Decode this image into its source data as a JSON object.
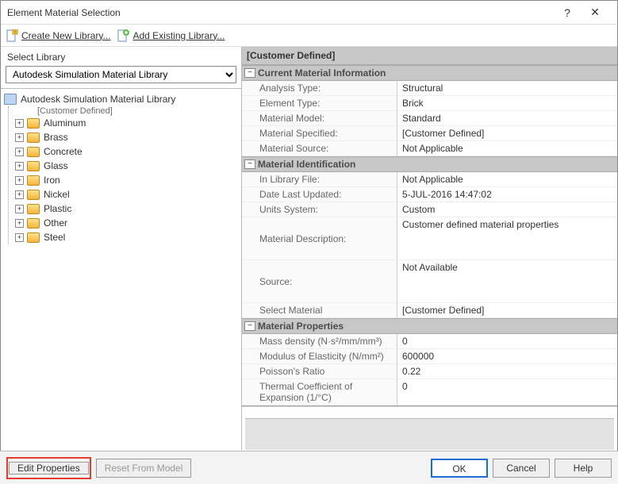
{
  "window": {
    "title": "Element Material Selection"
  },
  "toolbar": {
    "create": "Create New Library...",
    "add": "Add Existing Library..."
  },
  "left": {
    "heading": "Select Library",
    "selected": "Autodesk Simulation Material Library",
    "rootLabel": "Autodesk Simulation Material Library",
    "customer": "[Customer Defined]",
    "folders": [
      "Aluminum",
      "Brass",
      "Concrete",
      "Glass",
      "Iron",
      "Nickel",
      "Plastic",
      "Other",
      "Steel"
    ]
  },
  "selectedTitle": "[Customer Defined]",
  "sections": {
    "s1": {
      "title": "Current Material Information",
      "rows": [
        {
          "k": "Analysis Type:",
          "v": "Structural"
        },
        {
          "k": "Element Type:",
          "v": "Brick"
        },
        {
          "k": "Material Model:",
          "v": "Standard"
        },
        {
          "k": "Material Specified:",
          "v": "[Customer Defined]"
        },
        {
          "k": "Material Source:",
          "v": "Not Applicable"
        }
      ]
    },
    "s2": {
      "title": "Material Identification",
      "rows": [
        {
          "k": "In Library File:",
          "v": "Not Applicable"
        },
        {
          "k": "Date Last Updated:",
          "v": "5-JUL-2016 14:47:02"
        },
        {
          "k": "Units System:",
          "v": "Custom"
        },
        {
          "k": "Material Description:",
          "v": "Customer defined material properties"
        },
        {
          "k": "Source:",
          "v": "Not Available"
        },
        {
          "k": "Select Material",
          "v": "[Customer Defined]"
        }
      ]
    },
    "s3": {
      "title": "Material Properties",
      "rows": [
        {
          "k": "Mass density (N·s²/mm/mm³)",
          "v": "0"
        },
        {
          "k": "Modulus of Elasticity (N/mm²)",
          "v": "600000"
        },
        {
          "k": "Poisson's Ratio",
          "v": "0.22"
        },
        {
          "k": "Thermal Coefficient of Expansion (1/°C)",
          "v": "0"
        }
      ]
    }
  },
  "footer": {
    "edit": "Edit Properties",
    "reset": "Reset From Model",
    "ok": "OK",
    "cancel": "Cancel",
    "help": "Help"
  }
}
